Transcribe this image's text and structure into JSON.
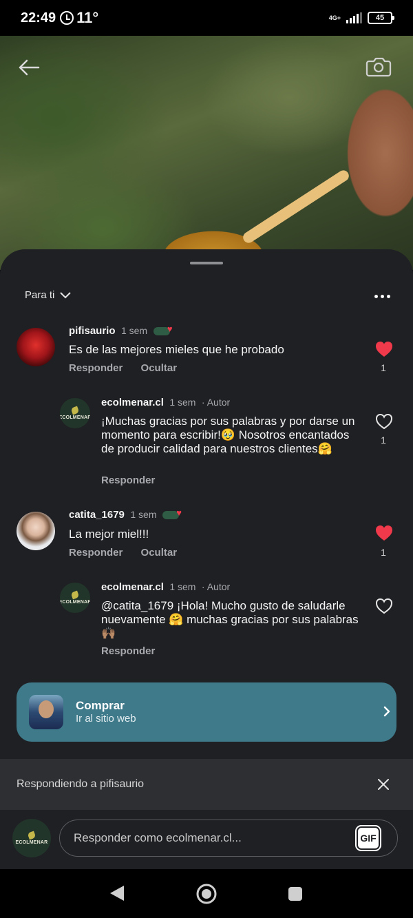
{
  "status": {
    "time": "22:49",
    "temp": "11°",
    "network": "4G+",
    "battery": "45"
  },
  "sheet": {
    "sort_label": "Para ti"
  },
  "comments": [
    {
      "username": "pifisaurio",
      "time": "1 sem",
      "text": "Es de las mejores mieles que he probado",
      "reply_label": "Responder",
      "hide_label": "Ocultar",
      "likes": "1",
      "liked": true
    },
    {
      "username": "ecolmenar.cl",
      "time": "1 sem",
      "role": "· Autor",
      "text": "¡Muchas gracias por sus palabras y por darse un momento para escribir!🥹 Nosotros encantados de producir calidad para nuestros clientes🤗",
      "reply_label": "Responder",
      "likes": "1",
      "liked": false
    },
    {
      "username": "catita_1679",
      "time": "1 sem",
      "text": "La mejor miel!!!",
      "reply_label": "Responder",
      "hide_label": "Ocultar",
      "likes": "1",
      "liked": true
    },
    {
      "username": "ecolmenar.cl",
      "time": "1 sem",
      "role": "· Autor",
      "text": "@catita_1679 ¡Hola! Mucho gusto de saludarle nuevamente 🤗 muchas gracias por sus palabras 🙌🏽",
      "reply_label": "Responder",
      "likes": "",
      "liked": false
    }
  ],
  "logo_word": "ECOLMENAR",
  "shop": {
    "title": "Comprar",
    "subtitle": "Ir al sitio web"
  },
  "replying": {
    "text": "Respondiendo a pifisaurio"
  },
  "composer": {
    "placeholder": "Responder como ecolmenar.cl...",
    "gif_label": "GIF"
  },
  "colors": {
    "sheet_bg": "#1f2024",
    "like_red": "#f0394a",
    "shop_bg": "#3f7a8a"
  },
  "icons": [
    "back-arrow-icon",
    "camera-icon",
    "chevron-down-icon",
    "more-icon",
    "heart-icon",
    "chevron-right-icon",
    "close-icon",
    "gif-icon",
    "back-icon",
    "home-icon",
    "recents-icon"
  ]
}
